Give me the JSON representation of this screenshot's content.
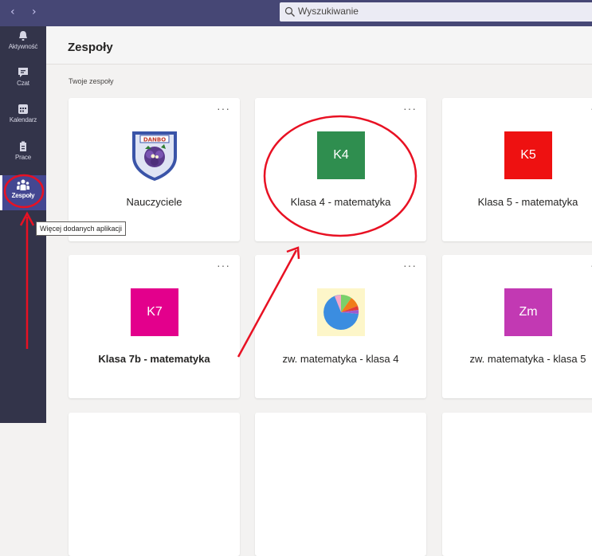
{
  "topbar": {
    "back_icon": "chevron-left-icon",
    "forward_icon": "chevron-right-icon",
    "search_placeholder": "Wyszukiwanie"
  },
  "rail": {
    "items": [
      {
        "label": "Aktywność",
        "icon": "bell-icon"
      },
      {
        "label": "Czat",
        "icon": "chat-icon"
      },
      {
        "label": "Kalendarz",
        "icon": "calendar-icon"
      },
      {
        "label": "Prace",
        "icon": "assignments-icon"
      },
      {
        "label": "Zespoły",
        "icon": "teams-icon"
      }
    ],
    "more_apps_tooltip": "Więcej dodanych aplikacji"
  },
  "header": {
    "title": "Zespoły"
  },
  "section_label": "Twoje zespoły",
  "teams": [
    {
      "name": "Nauczyciele",
      "badge": "",
      "badge_color": "",
      "type": "logo"
    },
    {
      "name": "Klasa 4 - matematyka",
      "badge": "K4",
      "badge_color": "#2f8e4f",
      "type": "badge"
    },
    {
      "name": "Klasa 5 - matematyka",
      "badge": "K5",
      "badge_color": "#ee1111",
      "type": "badge"
    },
    {
      "name": "Klasa 7b - matematyka",
      "badge": "K7",
      "badge_color": "#e3008c",
      "type": "badge"
    },
    {
      "name": "zw. matematyka - klasa 4",
      "badge": "",
      "badge_color": "",
      "type": "pie"
    },
    {
      "name": "zw. matematyka - klasa 5",
      "badge": "Zm",
      "badge_color": "#c239b3",
      "type": "badge"
    }
  ],
  "card_more_label": "···",
  "annotation_color": "#e81123"
}
